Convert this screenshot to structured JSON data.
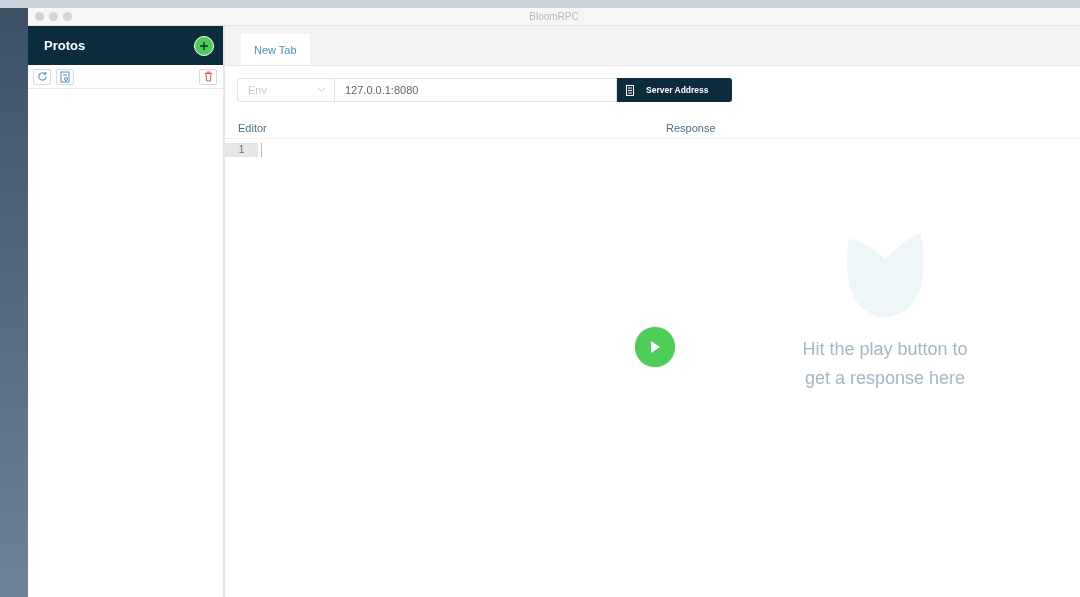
{
  "window": {
    "title": "BloomRPC"
  },
  "sidebar": {
    "title": "Protos"
  },
  "tabs": [
    {
      "label": "New Tab",
      "selected": true
    }
  ],
  "env_select": {
    "placeholder": "Env"
  },
  "address": {
    "value": "127.0.0.1:8080"
  },
  "server_button": {
    "label": "Server Address"
  },
  "editor": {
    "label": "Editor",
    "line_numbers": [
      "1"
    ]
  },
  "response": {
    "label": "Response",
    "hint": "Hit the play button to get a response here"
  }
}
